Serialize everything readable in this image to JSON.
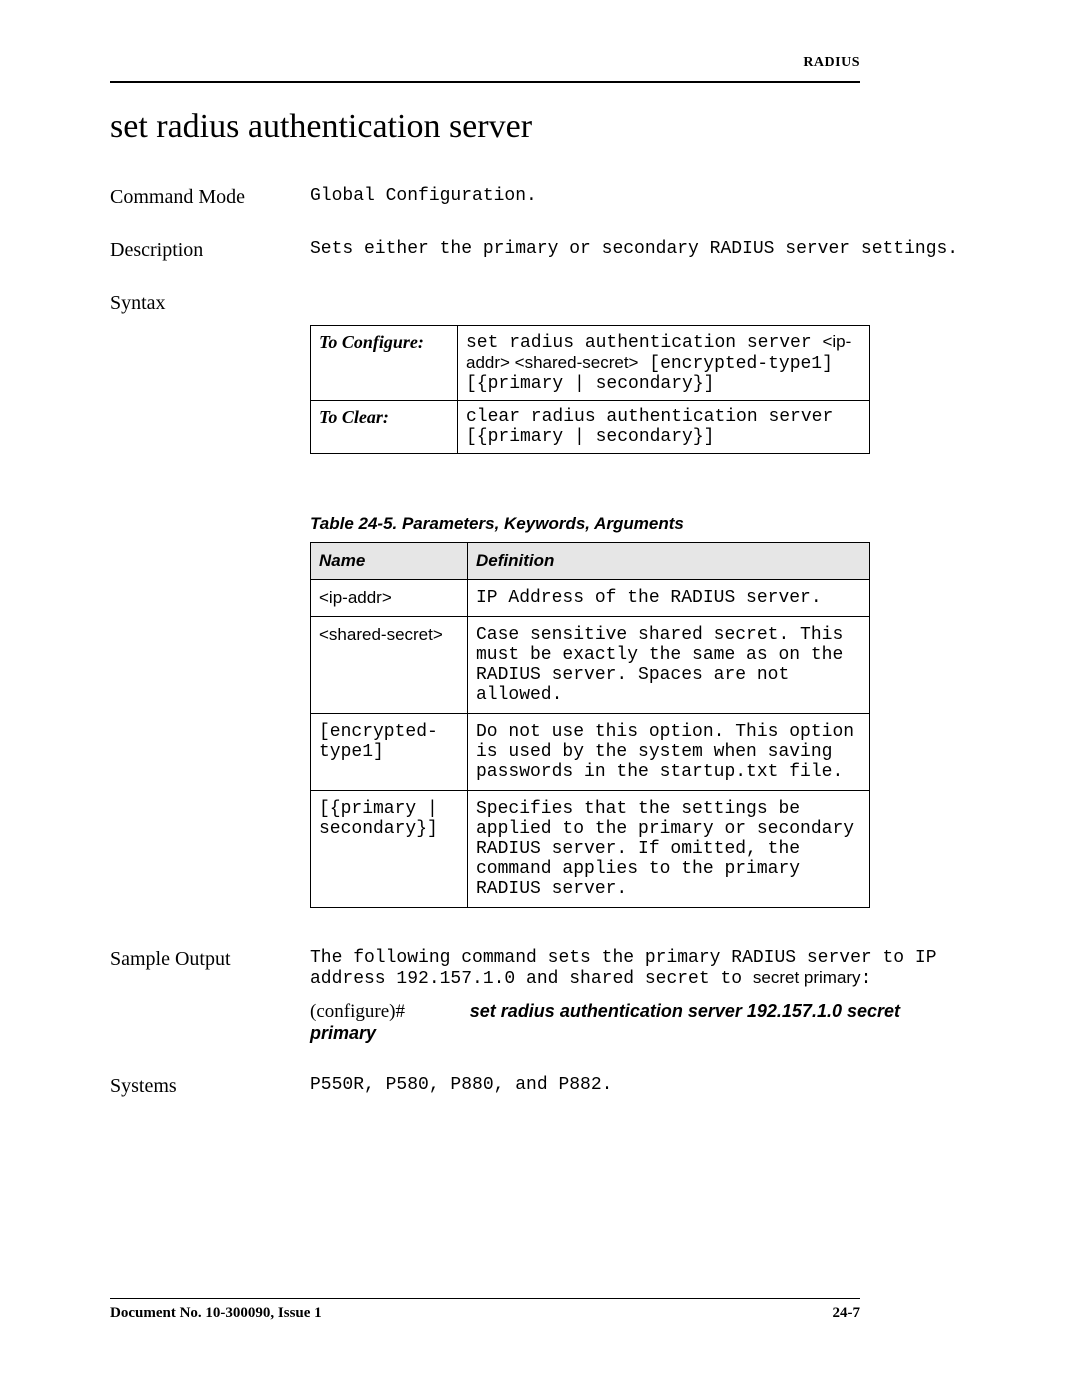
{
  "header": {
    "section": "RADIUS"
  },
  "title": "set radius authentication server",
  "command_mode": {
    "label": "Command Mode",
    "value": "Global Configuration."
  },
  "description": {
    "label": "Description",
    "value": "Sets either the primary or secondary RADIUS server settings."
  },
  "syntax": {
    "label": "Syntax",
    "rows": [
      {
        "label": "To Configure:",
        "prefix": "set radius authentication server ",
        "args_sans": "<ip-addr> <shared-secret>",
        "suffix": " [encrypted-type1] [{primary | secondary}]"
      },
      {
        "label": "To Clear:",
        "text": "clear radius authentication server [{primary | secondary}]"
      }
    ]
  },
  "params": {
    "caption": "Table 24-5.  Parameters, Keywords, Arguments",
    "headers": {
      "name": "Name",
      "definition": "Definition"
    },
    "rows": [
      {
        "name_style": "sans",
        "name": "<ip-addr>",
        "def": "IP Address of the RADIUS server."
      },
      {
        "name_style": "sans",
        "name": "<shared-secret>",
        "def": "Case sensitive shared secret. This must be exactly the same as on the RADIUS server. Spaces are not allowed."
      },
      {
        "name_style": "mono",
        "name": "[encrypted-type1]",
        "def": "Do not use this option. This option is used by the system when saving passwords in the startup.txt file."
      },
      {
        "name_style": "mono",
        "name": "[{primary | secondary}]",
        "def": "Specifies that the settings be applied to the primary or secondary RADIUS server. If omitted, the command applies to the primary RADIUS server."
      }
    ]
  },
  "sample": {
    "label": "Sample Output",
    "intro_prefix": "The following command sets the primary RADIUS server to IP address 192.157.1.0 and shared secret to ",
    "intro_bold": "secret primary",
    "intro_suffix": ":",
    "prompt": "(configure)#",
    "cmd": "set radius authentication server 192.157.1.0 secret primary"
  },
  "systems": {
    "label": "Systems",
    "value": "P550R, P580, P880, and P882."
  },
  "footer": {
    "doc": "Document No. 10-300090, Issue 1",
    "page": "24-7"
  }
}
